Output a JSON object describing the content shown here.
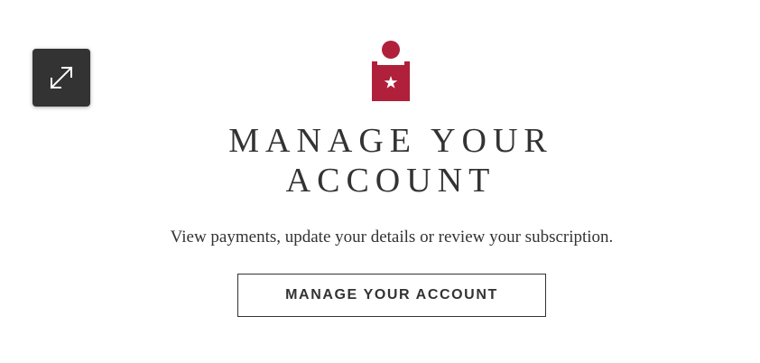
{
  "expand_button": {
    "icon": "expand-arrows-icon"
  },
  "account_icon": {
    "icon": "account-person-star-icon",
    "color": "#b0203a"
  },
  "title": "MANAGE YOUR ACCOUNT",
  "description": "View payments, update your details or review your subscription.",
  "cta": {
    "label": "MANAGE YOUR ACCOUNT"
  },
  "colors": {
    "text": "#333333",
    "accent": "#b0203a",
    "button_dark": "#333333",
    "background": "#ffffff"
  }
}
